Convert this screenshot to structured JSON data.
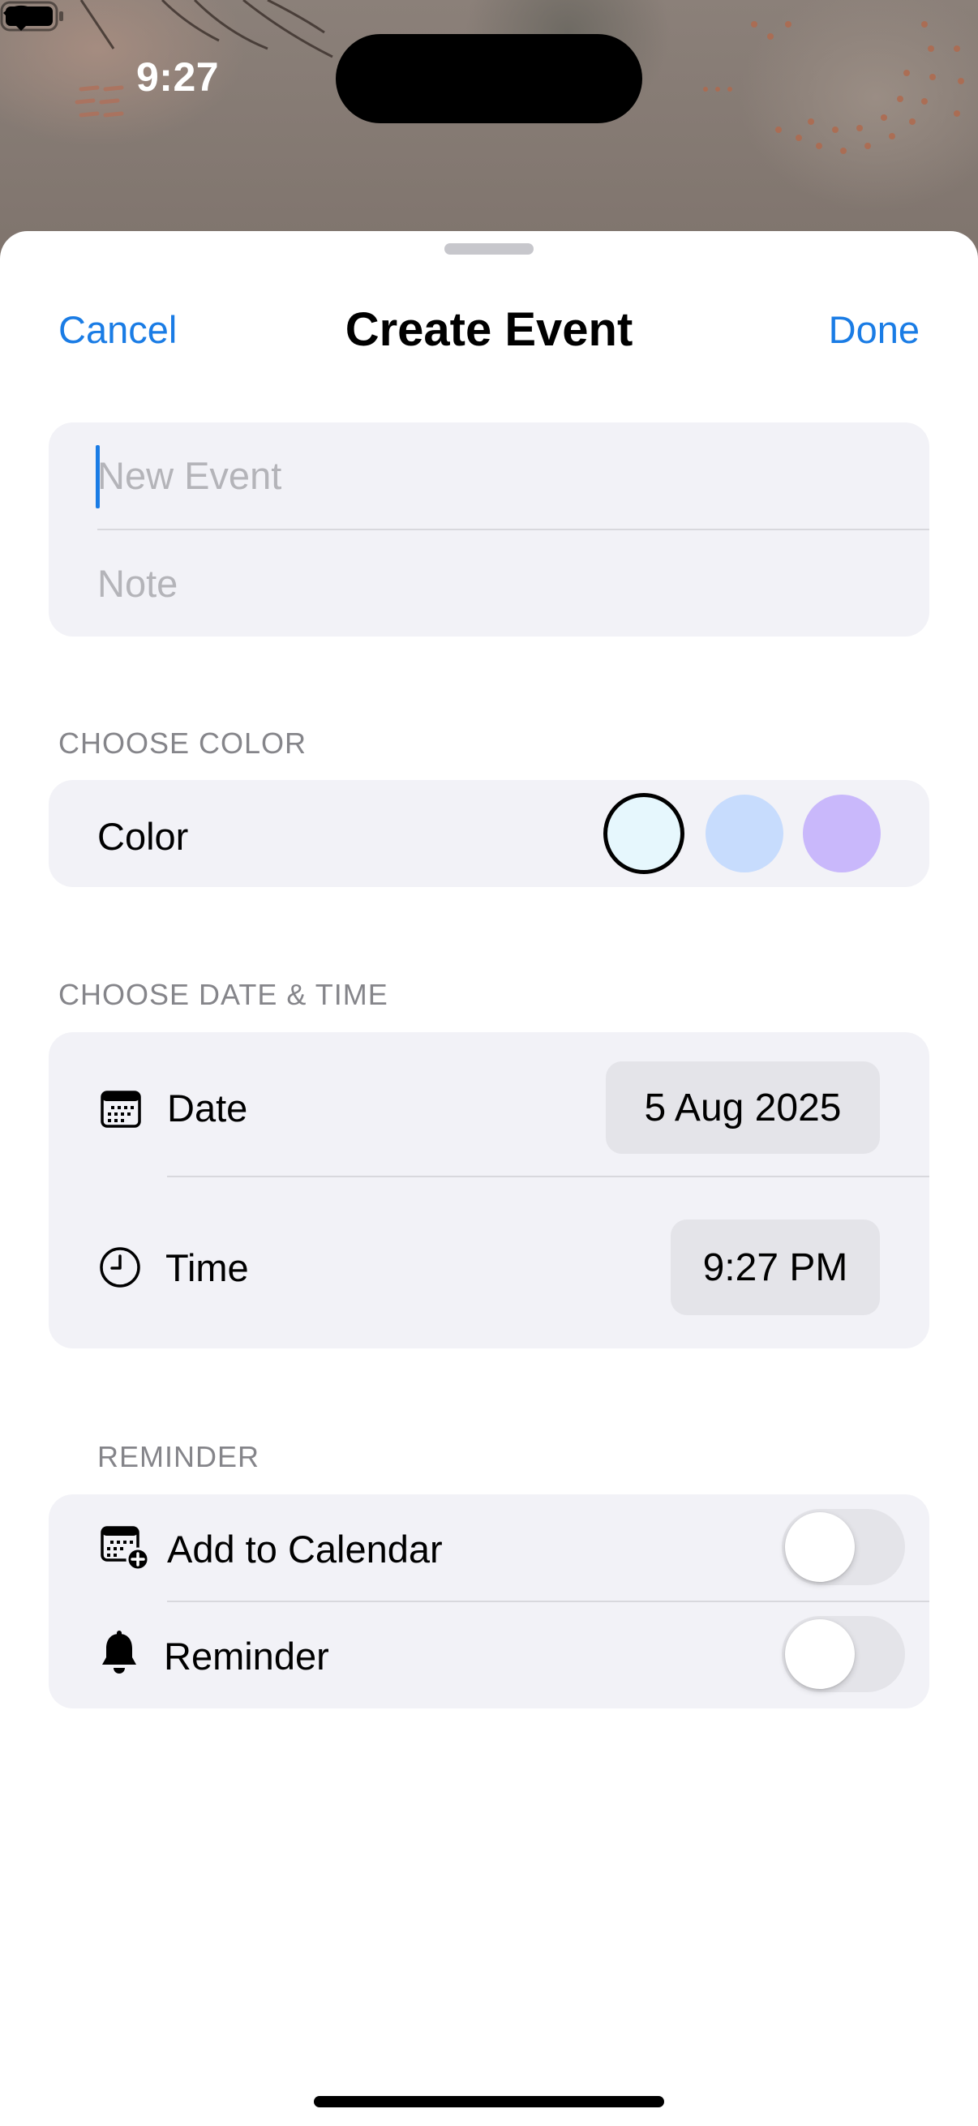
{
  "status_bar": {
    "time": "9:27",
    "wifi_icon": "wifi-icon",
    "battery_icon": "battery-icon"
  },
  "nav": {
    "cancel_label": "Cancel",
    "title": "Create Event",
    "done_label": "Done"
  },
  "details": {
    "title_placeholder": "New Event",
    "title_value": "",
    "note_placeholder": "Note",
    "note_value": ""
  },
  "color_section": {
    "header": "CHOOSE COLOR",
    "label": "Color",
    "swatches": [
      {
        "color": "#e6f7fd",
        "selected": true
      },
      {
        "color": "#c7dcfd",
        "selected": false
      },
      {
        "color": "#c9b8fb",
        "selected": false
      }
    ]
  },
  "datetime_section": {
    "header": "CHOOSE DATE & TIME",
    "date_label": "Date",
    "date_value": "5 Aug 2025",
    "date_icon": "calendar-icon",
    "time_label": "Time",
    "time_value": "9:27 PM",
    "time_icon": "clock-icon"
  },
  "reminder_section": {
    "header": "REMINDER",
    "add_to_calendar_label": "Add to Calendar",
    "add_to_calendar_on": false,
    "add_to_calendar_icon": "calendar-add-icon",
    "reminder_label": "Reminder",
    "reminder_on": false,
    "reminder_icon": "bell-icon"
  },
  "colors": {
    "accent": "#1a7ce5",
    "group_background": "#f2f2f7",
    "pill_background": "#e4e4e9"
  }
}
